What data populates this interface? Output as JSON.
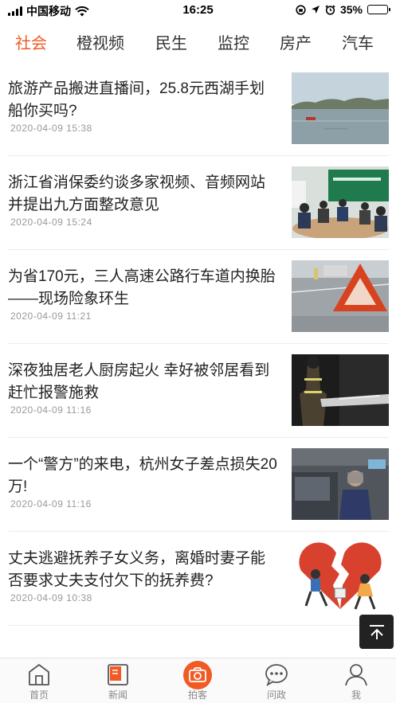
{
  "status_bar": {
    "carrier": "中国移动",
    "time": "16:25",
    "battery": "35%",
    "battery_level": 0.35
  },
  "tabs": [
    {
      "label": "社会",
      "active": true
    },
    {
      "label": "橙视频"
    },
    {
      "label": "民生"
    },
    {
      "label": "监控"
    },
    {
      "label": "房产"
    },
    {
      "label": "汽车"
    }
  ],
  "feed": [
    {
      "title": "旅游产品搬进直播间，25.8元西湖手划船你买吗?",
      "date": "2020-04-09 15:38",
      "image": "west-lake-boat-photo"
    },
    {
      "title": "浙江省消保委约谈多家视频、音频网站 并提出九方面整改意见",
      "date": "2020-04-09 15:24",
      "image": "meeting-room-photo"
    },
    {
      "title": "为省170元，三人高速公路行车道内换胎——现场险象环生",
      "date": "2020-04-09 11:21",
      "image": "warning-triangle-photo"
    },
    {
      "title": "深夜独居老人厨房起火 幸好被邻居看到赶忙报警施救",
      "date": "2020-04-09 11:16",
      "image": "firefighter-photo"
    },
    {
      "title": "一个“警方”的来电，杭州女子差点损失20万!",
      "date": "2020-04-09 11:16",
      "image": "woman-at-counter-photo"
    },
    {
      "title": "丈夫逃避抚养子女义务，离婚时妻子能否要求丈夫支付欠下的抚养费?",
      "date": "2020-04-09 10:38",
      "image": "broken-heart-cartoon"
    }
  ],
  "bottom_nav": [
    {
      "label": "首页",
      "icon": "home-icon"
    },
    {
      "label": "新闻",
      "icon": "news-icon"
    },
    {
      "label": "拍客",
      "icon": "camera-icon",
      "active": true
    },
    {
      "label": "问政",
      "icon": "chat-icon"
    },
    {
      "label": "我",
      "icon": "user-icon"
    }
  ],
  "colors": {
    "accent": "#f15a24"
  }
}
